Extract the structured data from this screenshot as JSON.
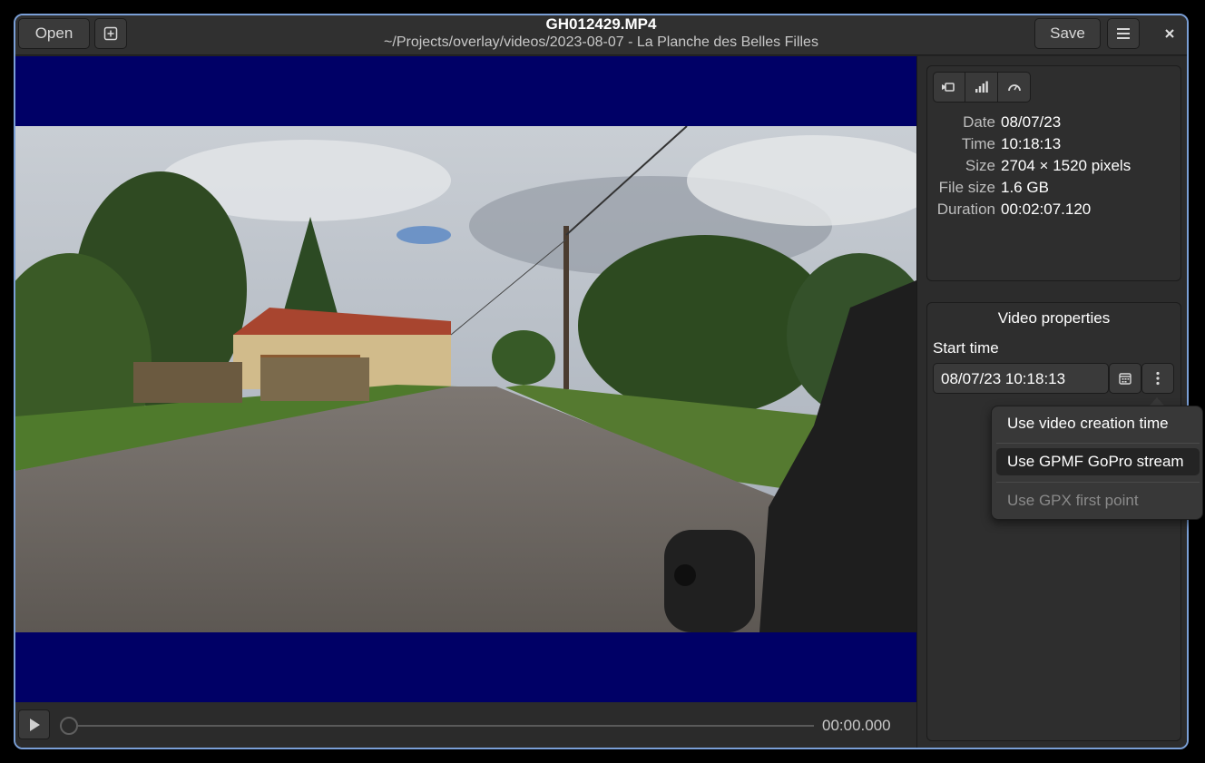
{
  "header": {
    "open_label": "Open",
    "save_label": "Save",
    "title": "GH012429.MP4",
    "subtitle": "~/Projects/overlay/videos/2023-08-07 - La Planche des Belles Filles",
    "icons": {
      "new": "add-square-icon",
      "menu": "hamburger-menu-icon",
      "close": "close-icon"
    }
  },
  "player": {
    "time": "00:00.000",
    "progress": 0.0,
    "letterbox_color": "#000066",
    "icons": {
      "play": "play-icon"
    }
  },
  "info_panel": {
    "tabs": [
      {
        "icon": "video-camera-icon"
      },
      {
        "icon": "signal-bars-icon"
      },
      {
        "icon": "speedometer-icon"
      }
    ],
    "rows": [
      {
        "key": "Date",
        "value": "08/07/23"
      },
      {
        "key": "Time",
        "value": "10:18:13"
      },
      {
        "key": "Size",
        "value": "2704 × 1520 pixels"
      },
      {
        "key": "File size",
        "value": "1.6 GB"
      },
      {
        "key": "Duration",
        "value": "00:02:07.120"
      }
    ]
  },
  "video_properties": {
    "title": "Video properties",
    "start_label": "Start time",
    "start_value": "08/07/23 10:18:13",
    "icons": {
      "calendar": "calendar-icon",
      "more": "vertical-dots-icon"
    }
  },
  "start_menu": {
    "items": [
      {
        "label": "Use video creation time",
        "state": "normal"
      },
      {
        "label": "Use GPMF GoPro stream",
        "state": "highlighted"
      },
      {
        "label": "Use GPX first point",
        "state": "disabled"
      }
    ]
  },
  "colors": {
    "window_border": "#7a9fd6",
    "window_bg": "#242424",
    "headerbar_bg": "#303030"
  }
}
